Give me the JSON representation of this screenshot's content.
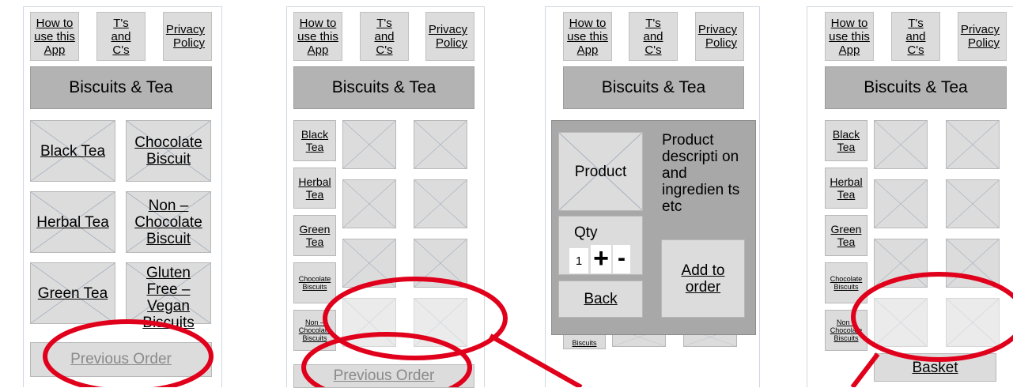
{
  "nav": {
    "how_to": "How to use this App",
    "ts_and_cs": "T's and C's",
    "privacy": "Privacy Policy"
  },
  "app_title": "Biscuits & Tea",
  "screen1": {
    "categories": [
      "Black Tea",
      "Chocolate Biscuit",
      "Herbal Tea",
      "Non – Chocolate Biscuit",
      "Green Tea",
      "Gluten Free – Vegan Biscuits"
    ],
    "previous_order": "Previous Order"
  },
  "side_categories": [
    "Black Tea",
    "Herbal Tea",
    "Green Tea",
    "Chocolate Biscuits",
    "Non – Chocolate Biscuits"
  ],
  "screen2": {
    "previous_order": "Previous Order"
  },
  "screen3": {
    "product": "Product",
    "description": "Product descripti on and ingredien ts etc",
    "qty_label": "Qty",
    "qty_value": "1",
    "plus": "+",
    "minus": "-",
    "add_to_order": "Add to order",
    "back": "Back",
    "behind_label": "Biscuits"
  },
  "screen4": {
    "basket": "Basket"
  },
  "annotation_color": "#e0001b"
}
